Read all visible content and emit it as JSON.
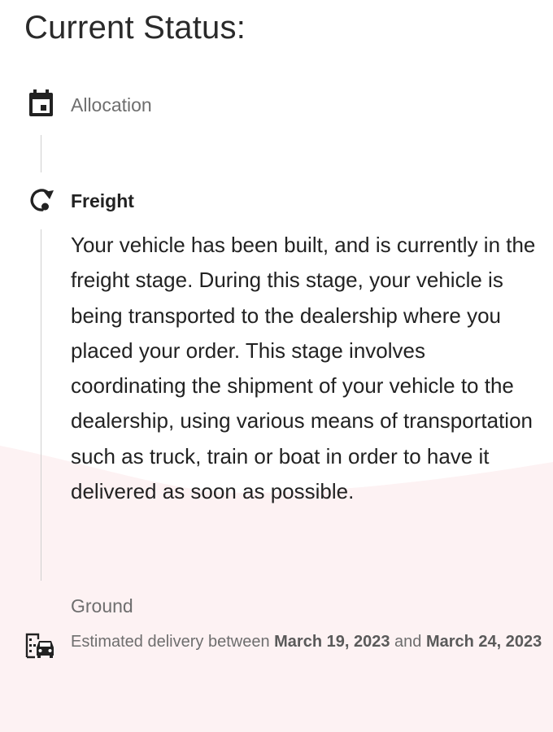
{
  "status": {
    "heading": "Current Status:"
  },
  "steps": [
    {
      "label": "Allocation",
      "icon": "calendar-icon",
      "state": "completed"
    },
    {
      "label": "Freight",
      "icon": "freight-cycle-icon",
      "state": "current",
      "description": "Your vehicle has been built, and is currently in the freight stage. During this stage, your vehicle is being transported to the dealership where you placed your order. This stage involves coordinating the shipment of your vehicle to the dealership, using various means of transportation such as truck, train or boat in order to have it delivered as soon as possible."
    },
    {
      "label": "Ground",
      "icon": "dealership-car-icon",
      "state": "upcoming",
      "delivery_prefix": "Estimated delivery between",
      "delivery_start": "March 19, 2023",
      "delivery_joiner": "and",
      "delivery_end": "March 24, 2023"
    }
  ],
  "colors": {
    "background": "#ffffff",
    "wave": "#fdf2f3",
    "connector": "#cfcfcf",
    "text_primary": "#222222",
    "text_muted": "#6e6e6e"
  }
}
